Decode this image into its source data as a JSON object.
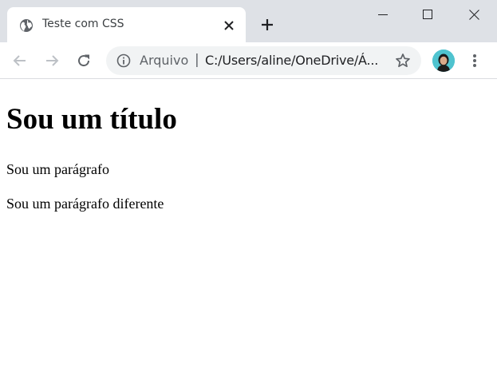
{
  "browser": {
    "tab": {
      "title": "Teste com CSS",
      "icon": "globe-icon"
    },
    "window_controls": [
      "minimize-icon",
      "maximize-icon",
      "close-icon"
    ],
    "address_bar": {
      "security_label": "Arquivo",
      "separator": "|",
      "url": "C:/Users/aline/OneDrive/Á..."
    },
    "colors": {
      "tab_strip": "#dee1e6",
      "omnibox_bg": "#f1f3f4",
      "icon": "#5f6368"
    }
  },
  "page": {
    "heading": "Sou um título",
    "paragraphs": [
      "Sou um parágrafo",
      "Sou um parágrafo diferente"
    ]
  }
}
